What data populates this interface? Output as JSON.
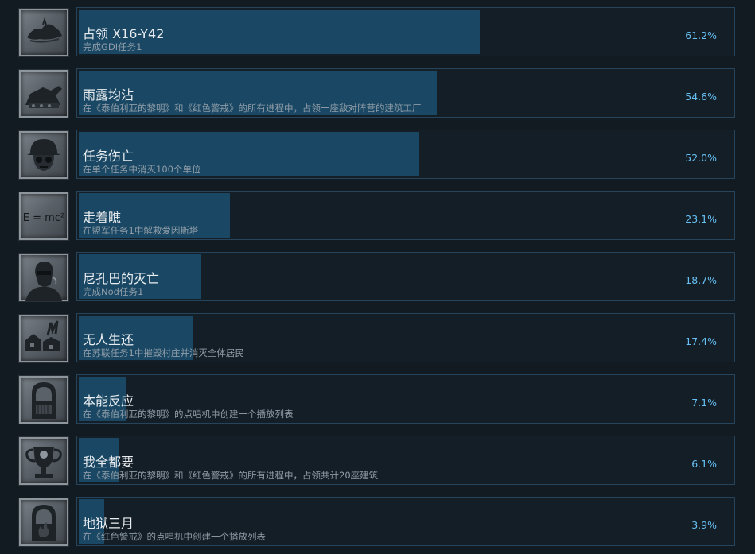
{
  "achievements": [
    {
      "title": "占领 X16-Y42",
      "description": "完成GDI任务1",
      "percent_text": "61.2%",
      "percent": 61.2,
      "icon": "island-icon"
    },
    {
      "title": "雨露均沾",
      "description": "在《泰伯利亚的黎明》和《红色警戒》的所有进程中，占领一座敌对阵营的建筑工厂",
      "percent_text": "54.6%",
      "percent": 54.6,
      "icon": "tank-icon"
    },
    {
      "title": "任务伤亡",
      "description": "在单个任务中消灭100个单位",
      "percent_text": "52.0%",
      "percent": 52.0,
      "icon": "helmet-skull-icon"
    },
    {
      "title": "走着瞧",
      "description": "在盟军任务1中解救爱因斯塔",
      "percent_text": "23.1%",
      "percent": 23.1,
      "icon": "formula-icon"
    },
    {
      "title": "尼孔巴的灭亡",
      "description": "完成Nod任务1",
      "percent_text": "18.7%",
      "percent": 18.7,
      "icon": "commander-portrait-icon"
    },
    {
      "title": "无人生还",
      "description": "在苏联任务1中摧毁村庄并消灭全体居民",
      "percent_text": "17.4%",
      "percent": 17.4,
      "icon": "burning-village-icon"
    },
    {
      "title": "本能反应",
      "description": "在《泰伯利亚的黎明》的点唱机中创建一个播放列表",
      "percent_text": "7.1%",
      "percent": 7.1,
      "icon": "jukebox-icon"
    },
    {
      "title": "我全都要",
      "description": "在《泰伯利亚的黎明》和《红色警戒》的所有进程中，占领共计20座建筑",
      "percent_text": "6.1%",
      "percent": 6.1,
      "icon": "trophy-icon"
    },
    {
      "title": "地狱三月",
      "description": "在《红色警戒》的点唱机中创建一个播放列表",
      "percent_text": "3.9%",
      "percent": 3.9,
      "icon": "jukebox-flame-icon"
    }
  ]
}
